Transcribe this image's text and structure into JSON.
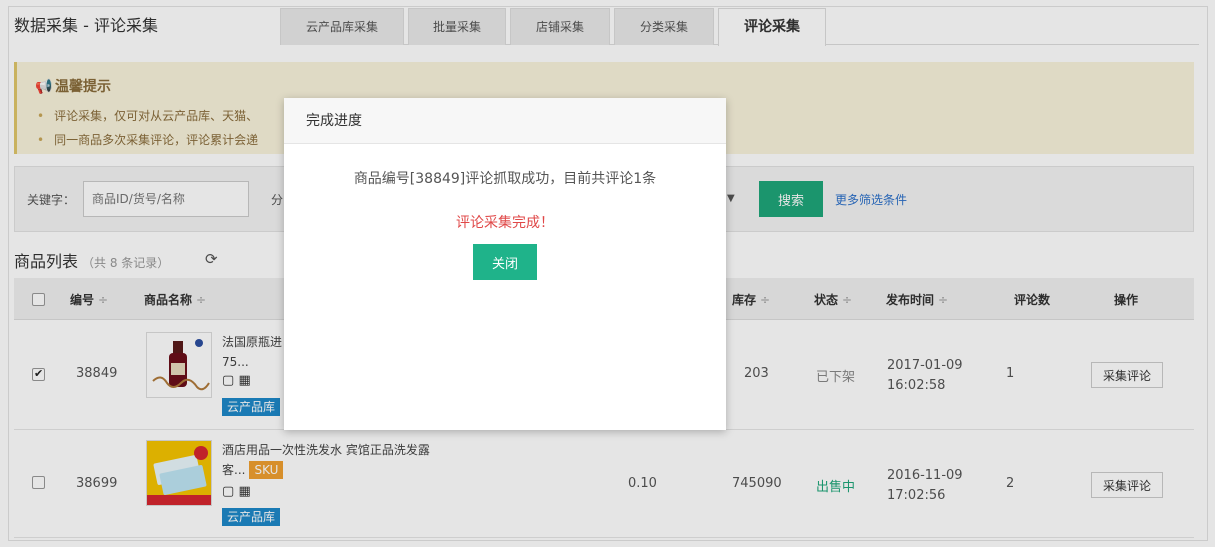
{
  "header": {
    "title": "数据采集 - 评论采集",
    "tabs": [
      {
        "label": "云产品库采集"
      },
      {
        "label": "批量采集"
      },
      {
        "label": "店铺采集"
      },
      {
        "label": "分类采集"
      },
      {
        "label": "评论采集",
        "active": true
      }
    ]
  },
  "notice": {
    "title": "温馨提示",
    "items": [
      "评论采集，仅可对从云产品库、天猫、",
      "同一商品多次采集评论，评论累计会递"
    ]
  },
  "filter": {
    "keyword_label": "关键字：",
    "keyword_placeholder": "商品ID/货号/名称",
    "label2": "分",
    "search_label": "搜索",
    "more_label": "更多筛选条件"
  },
  "list": {
    "title": "商品列表",
    "count": "（共 8 条记录）",
    "columns": {
      "id": "编号",
      "name": "商品名称",
      "stock": "库存",
      "status": "状态",
      "date": "发布时间",
      "reviews": "评论数",
      "action": "操作"
    },
    "sort_glyph": "÷",
    "rows": [
      {
        "checked": true,
        "id": "38849",
        "name_line1": "法国原瓶进",
        "name_line2": "75...",
        "tag": "云产品库",
        "price": "",
        "stock": "203",
        "status": "已下架",
        "date": "2017-01-09",
        "time": "16:02:58",
        "reviews": "1",
        "action": "采集评论"
      },
      {
        "checked": false,
        "id": "38699",
        "name_line1": "酒店用品一次性洗发水 宾馆正品洗发露",
        "name_line2": "客...",
        "sku": "SKU",
        "tag": "云产品库",
        "price": "0.10",
        "stock": "745090",
        "status": "出售中",
        "date": "2016-11-09",
        "time": "17:02:56",
        "reviews": "2",
        "action": "采集评论"
      }
    ]
  },
  "modal": {
    "title": "完成进度",
    "message": "商品编号[38849]评论抓取成功，目前共评论1条",
    "done": "评论采集完成！",
    "close_label": "关闭"
  },
  "colors": {
    "accent": "#1fa67a",
    "notice_bg": "#f9f3dc",
    "danger": "#e04848",
    "tag_blue": "#1e88c9",
    "tag_orange": "#f0a030"
  }
}
